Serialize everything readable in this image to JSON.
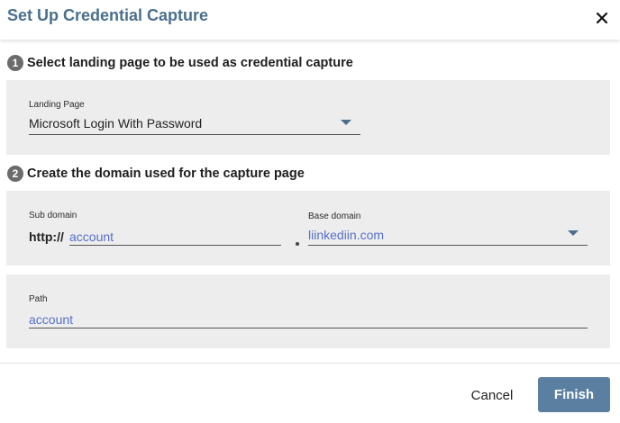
{
  "dialog": {
    "title": "Set Up Credential Capture"
  },
  "step1": {
    "number": "1",
    "text": "Select landing page to be used as credential capture",
    "landing_page": {
      "label": "Landing Page",
      "value": "Microsoft Login With Password"
    }
  },
  "step2": {
    "number": "2",
    "text": "Create the domain used for the capture page",
    "sub_domain": {
      "label": "Sub domain",
      "prefix": "http://",
      "value": "account"
    },
    "base_domain": {
      "label": "Base domain",
      "value": "liinkediin.com"
    },
    "path": {
      "label": "Path",
      "value": "account"
    }
  },
  "footer": {
    "cancel_label": "Cancel",
    "finish_label": "Finish"
  },
  "icons": {
    "close": "close-icon",
    "dropdown": "chevron-down-icon"
  },
  "colors": {
    "title": "#4a6f8e",
    "accent_button": "#5a7fa1",
    "value_link": "#5570c9",
    "panel_bg": "#ededed"
  }
}
